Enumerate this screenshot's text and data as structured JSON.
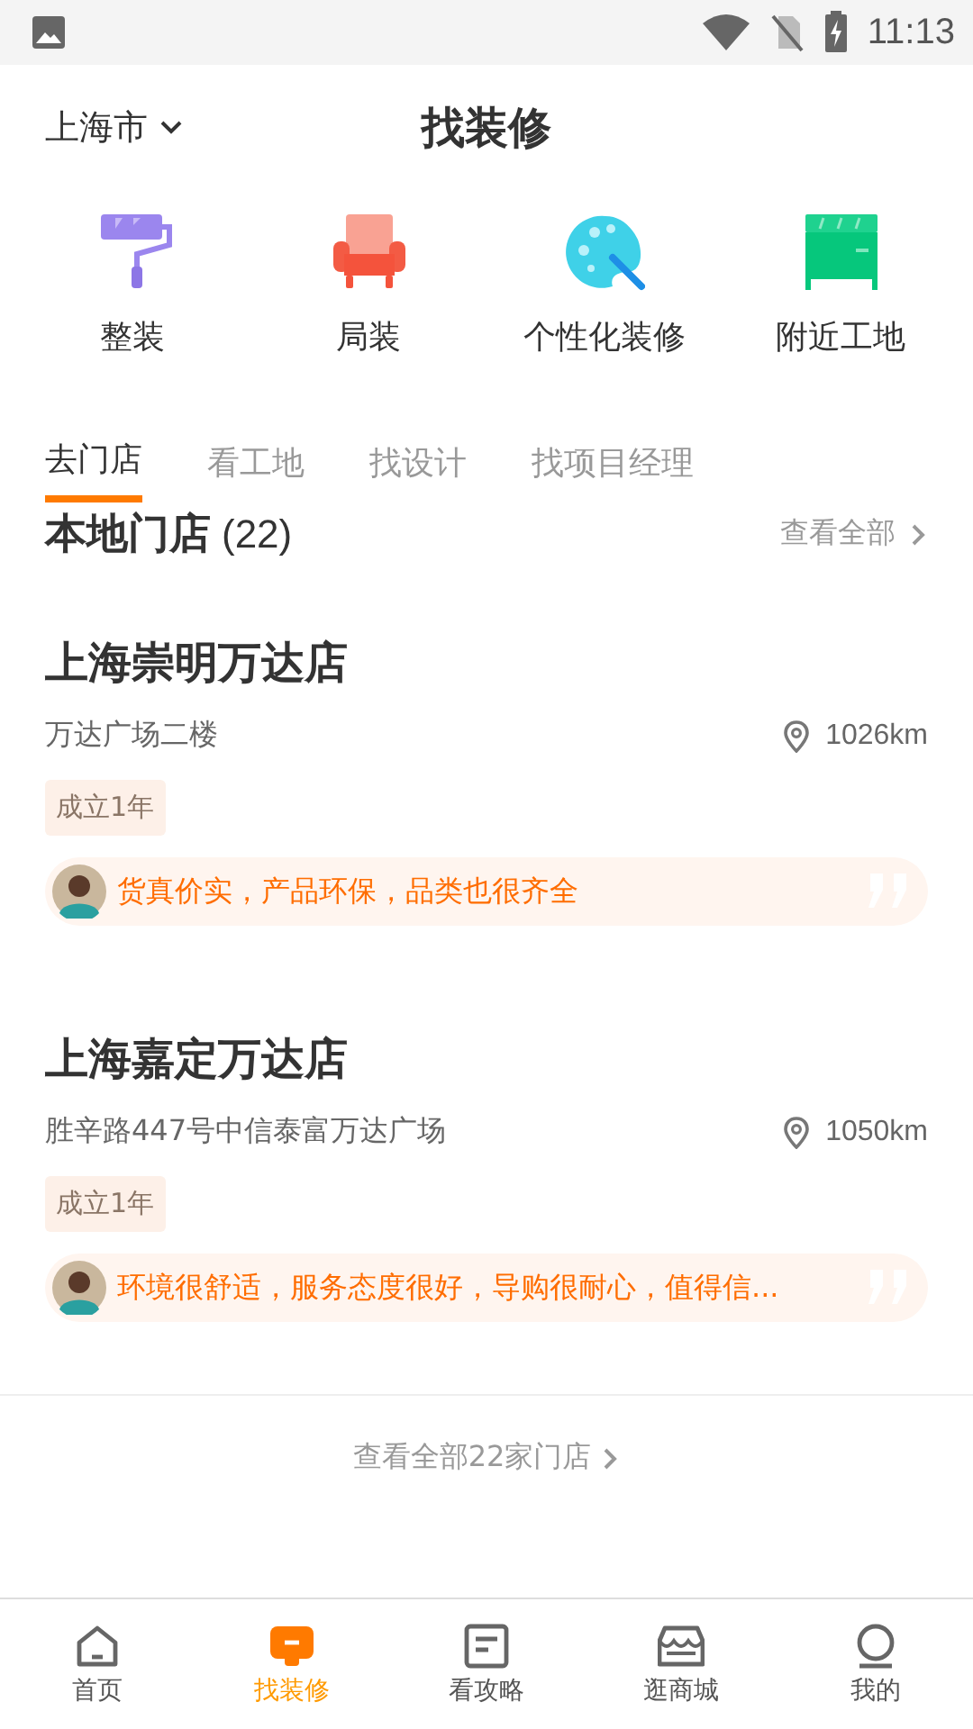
{
  "status_bar": {
    "time": "11:13"
  },
  "header": {
    "city": "上海市",
    "title": "找装修"
  },
  "categories": [
    {
      "label": "整装",
      "kind": "roller"
    },
    {
      "label": "局装",
      "kind": "sofa"
    },
    {
      "label": "个性化装修",
      "kind": "palette"
    },
    {
      "label": "附近工地",
      "kind": "cabinet"
    }
  ],
  "tabs": [
    {
      "label": "去门店",
      "selected": true
    },
    {
      "label": "看工地",
      "selected": false
    },
    {
      "label": "找设计",
      "selected": false
    },
    {
      "label": "找项目经理",
      "selected": false
    }
  ],
  "section": {
    "title": "本地门店",
    "count": "(22)",
    "view_all": "查看全部"
  },
  "stores": [
    {
      "name": "上海崇明万达店",
      "address": "万达广场二楼",
      "distance": "1026km",
      "tag": "成立1年",
      "review": "货真价实，产品环保，品类也很齐全"
    },
    {
      "name": "上海嘉定万达店",
      "address": "胜辛路447号中信泰富万达广场",
      "distance": "1050km",
      "tag": "成立1年",
      "review": "环境很舒适，服务态度很好，导购很耐心，值得信..."
    }
  ],
  "all_stores_link": "查看全部22家门店",
  "bottom_nav": [
    {
      "label": "首页",
      "kind": "home",
      "selected": false
    },
    {
      "label": "找装修",
      "kind": "decor",
      "selected": true
    },
    {
      "label": "看攻略",
      "kind": "guide",
      "selected": false
    },
    {
      "label": "逛商城",
      "kind": "shop",
      "selected": false
    },
    {
      "label": "我的",
      "kind": "me",
      "selected": false
    }
  ]
}
